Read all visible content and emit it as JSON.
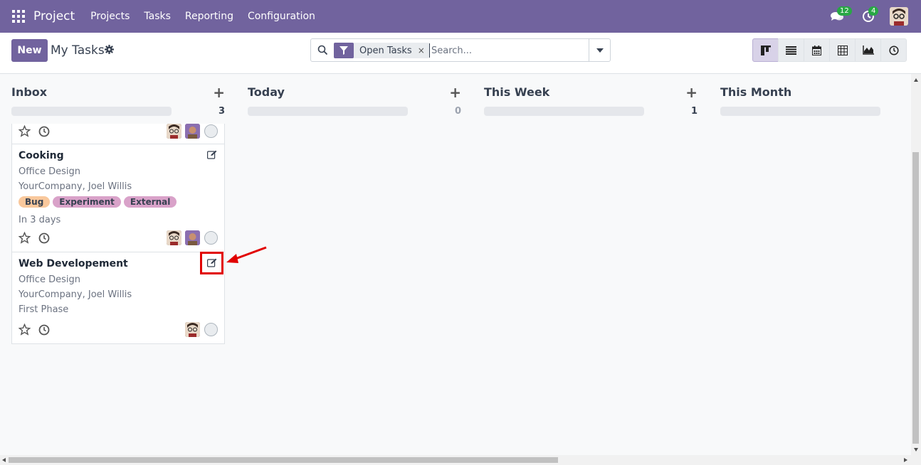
{
  "navbar": {
    "brand": "Project",
    "menu": [
      "Projects",
      "Tasks",
      "Reporting",
      "Configuration"
    ],
    "messages_count": "12",
    "activities_count": "4",
    "color": "#71639e"
  },
  "control_panel": {
    "new_label": "New",
    "title": "My Tasks",
    "search": {
      "facet": "Open Tasks",
      "facet_remove": "×",
      "placeholder": "Search..."
    },
    "views": [
      "kanban-icon",
      "list-icon",
      "calendar-icon",
      "pivot-icon",
      "graph-icon",
      "activity-icon"
    ],
    "active_view": "kanban"
  },
  "columns": [
    {
      "title": "Inbox",
      "count": "3",
      "add": "+"
    },
    {
      "title": "Today",
      "count": "0",
      "add": "+"
    },
    {
      "title": "This Week",
      "count": "1",
      "add": "+"
    },
    {
      "title": "This Month",
      "count": "",
      "add": ""
    }
  ],
  "cards": [
    {
      "title": "Cooking",
      "project": "Office Design",
      "customer": "YourCompany, Joel Willis",
      "tags": [
        {
          "label": "Bug",
          "color": "#f9c89c"
        },
        {
          "label": "Experiment",
          "color": "#d9a2c9"
        },
        {
          "label": "External",
          "color": "#d9a2c9"
        }
      ],
      "deadline": "In 3 days"
    },
    {
      "title": "Web Developement",
      "project": "Office Design",
      "customer": "YourCompany, Joel Willis",
      "stage": "First Phase"
    }
  ]
}
